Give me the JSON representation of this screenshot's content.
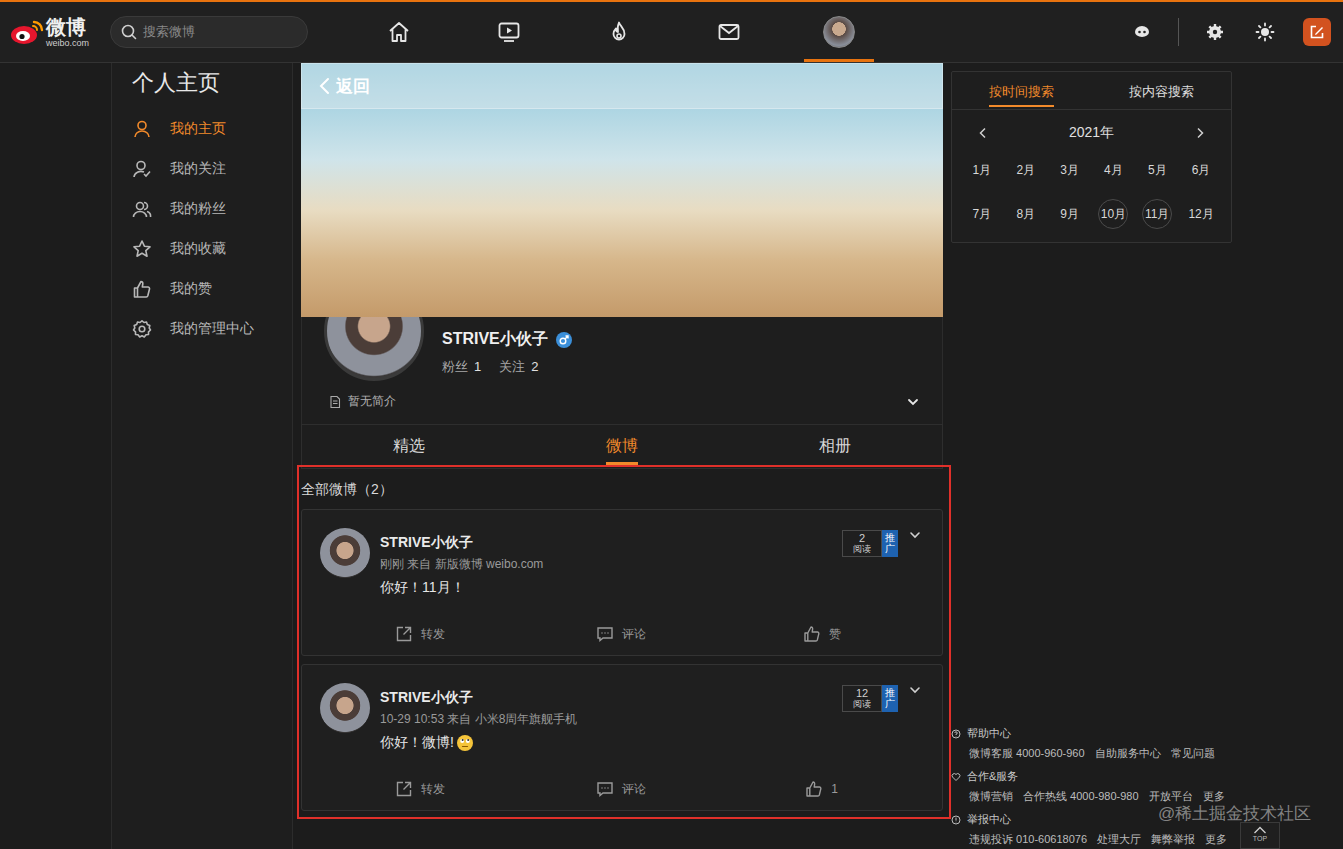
{
  "header": {
    "logo": {
      "name": "微博",
      "domain": "weibo.com"
    },
    "search": {
      "placeholder": "搜索微博"
    },
    "nav": [
      {
        "selected": false
      },
      {
        "selected": false
      },
      {
        "selected": false
      },
      {
        "selected": false
      },
      {
        "selected": true
      }
    ]
  },
  "sidebar": {
    "title": "个人主页",
    "items": [
      {
        "label": "我的主页",
        "selected": true
      },
      {
        "label": "我的关注",
        "selected": false
      },
      {
        "label": "我的粉丝",
        "selected": false
      },
      {
        "label": "我的收藏",
        "selected": false
      },
      {
        "label": "我的赞",
        "selected": false
      },
      {
        "label": "我的管理中心",
        "selected": false
      }
    ]
  },
  "profile": {
    "back": "返回",
    "name": "STRIVE小伙子",
    "gender": "male",
    "stats": [
      {
        "label": "粉丝",
        "value": "1"
      },
      {
        "label": "关注",
        "value": "2"
      }
    ],
    "bio": "暂无简介"
  },
  "tabs": [
    {
      "label": "精选",
      "selected": false
    },
    {
      "label": "微博",
      "selected": true
    },
    {
      "label": "相册",
      "selected": false
    }
  ],
  "feed": {
    "title": "全部微博（2）",
    "posts": [
      {
        "author": "STRIVE小伙子",
        "meta": "刚刚 来自 新版微博 weibo.com",
        "text": "你好！11月！",
        "emoji": false,
        "reads": "2",
        "reads_label": "阅读",
        "promote": "推广",
        "actions": [
          "转发",
          "评论",
          "赞"
        ]
      },
      {
        "author": "STRIVE小伙子",
        "meta": "10-29 10:53 来自 小米8周年旗舰手机",
        "text": "你好！微博!",
        "emoji": true,
        "reads": "12",
        "reads_label": "阅读",
        "promote": "推广",
        "actions": [
          "转发",
          "评论",
          "1"
        ]
      }
    ]
  },
  "calendar": {
    "tabs": [
      {
        "label": "按时间搜索",
        "selected": true
      },
      {
        "label": "按内容搜索",
        "selected": false
      }
    ],
    "year": "2021年",
    "months": [
      {
        "label": "1月",
        "has_posts": false
      },
      {
        "label": "2月",
        "has_posts": false
      },
      {
        "label": "3月",
        "has_posts": false
      },
      {
        "label": "4月",
        "has_posts": false
      },
      {
        "label": "5月",
        "has_posts": false
      },
      {
        "label": "6月",
        "has_posts": false
      },
      {
        "label": "7月",
        "has_posts": false
      },
      {
        "label": "8月",
        "has_posts": false
      },
      {
        "label": "9月",
        "has_posts": false
      },
      {
        "label": "10月",
        "has_posts": true
      },
      {
        "label": "11月",
        "has_posts": true
      },
      {
        "label": "12月",
        "has_posts": false
      }
    ]
  },
  "footer": {
    "sections": [
      {
        "title": "帮助中心",
        "links": [
          "微博客服 4000-960-960",
          "自助服务中心",
          "常见问题"
        ]
      },
      {
        "title": "合作&服务",
        "links": [
          "微博营销",
          "合作热线 4000-980-980",
          "开放平台",
          "更多"
        ]
      },
      {
        "title": "举报中心",
        "links": [
          "违规投诉 010-60618076",
          "处理大厅",
          "舞弊举报",
          "更多"
        ]
      }
    ]
  },
  "top_button": "TOP",
  "watermark": "@稀土掘金技术社区"
}
